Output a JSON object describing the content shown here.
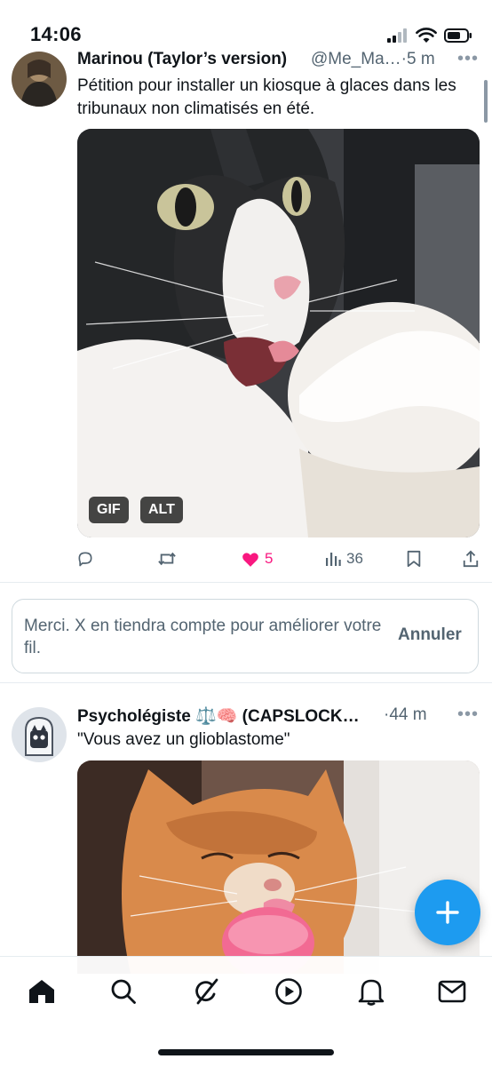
{
  "status_bar": {
    "time": "14:06",
    "battery_level": 0.7
  },
  "tweets": [
    {
      "author_name": "Marinou (Taylor’s version)",
      "handle_time": "@Me_Ma…·5 m",
      "text": "Pétition pour installer un kiosque à glaces dans les tribunaux non climatisés en été.",
      "media": {
        "type": "gif",
        "badges": [
          "GIF",
          "ALT"
        ]
      },
      "actions": {
        "reply": "",
        "retweet": "",
        "likes": "5",
        "views": "36"
      },
      "liked": true
    },
    {
      "author_name": "Psycholégiste ⚖️🧠 (CAPSLOCK…",
      "handle_time": "·44 m",
      "text": "\"Vous avez un glioblastome\"",
      "media": {
        "type": "image"
      }
    }
  ],
  "feedback": {
    "message": "Merci. X en tiendra compte pour améliorer votre fil.",
    "button": "Annuler"
  },
  "fab_icon": "plus-icon",
  "tab_bar": [
    {
      "icon": "home-icon",
      "active": true
    },
    {
      "icon": "search-icon"
    },
    {
      "icon": "grok-icon"
    },
    {
      "icon": "video-icon"
    },
    {
      "icon": "notifications-icon"
    },
    {
      "icon": "messages-icon"
    }
  ],
  "colors": {
    "accent": "#1d9bf0",
    "like": "#f91880",
    "text": "#0f1419",
    "secondary": "#536471"
  }
}
